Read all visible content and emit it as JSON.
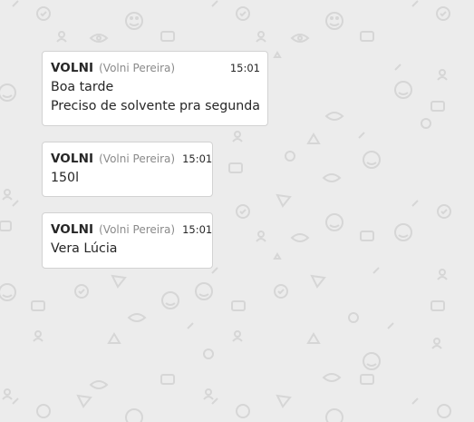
{
  "messages": [
    {
      "sender": "VOLNI",
      "full_name": "(Volni Pereira)",
      "time": "15:01",
      "lines": [
        "Boa tarde",
        "Preciso de solvente pra segunda"
      ]
    },
    {
      "sender": "VOLNI",
      "full_name": "(Volni Pereira)",
      "time": "15:01",
      "lines": [
        "150l"
      ]
    },
    {
      "sender": "VOLNI",
      "full_name": "(Volni Pereira)",
      "time": "15:01",
      "lines": [
        "Vera Lúcia"
      ]
    }
  ],
  "colors": {
    "background": "#ececec",
    "bubble": "#ffffff",
    "bubble_border": "#d2d2d2",
    "text": "#262626",
    "muted_text": "#8a8a8a",
    "pattern": "#d8d8d8"
  },
  "background_pattern_icons": [
    "smiley-icon",
    "checkmark-icon",
    "eye-icon",
    "pill-icon",
    "user-add-icon",
    "send-icon",
    "triangle-icon",
    "envelope-icon"
  ]
}
